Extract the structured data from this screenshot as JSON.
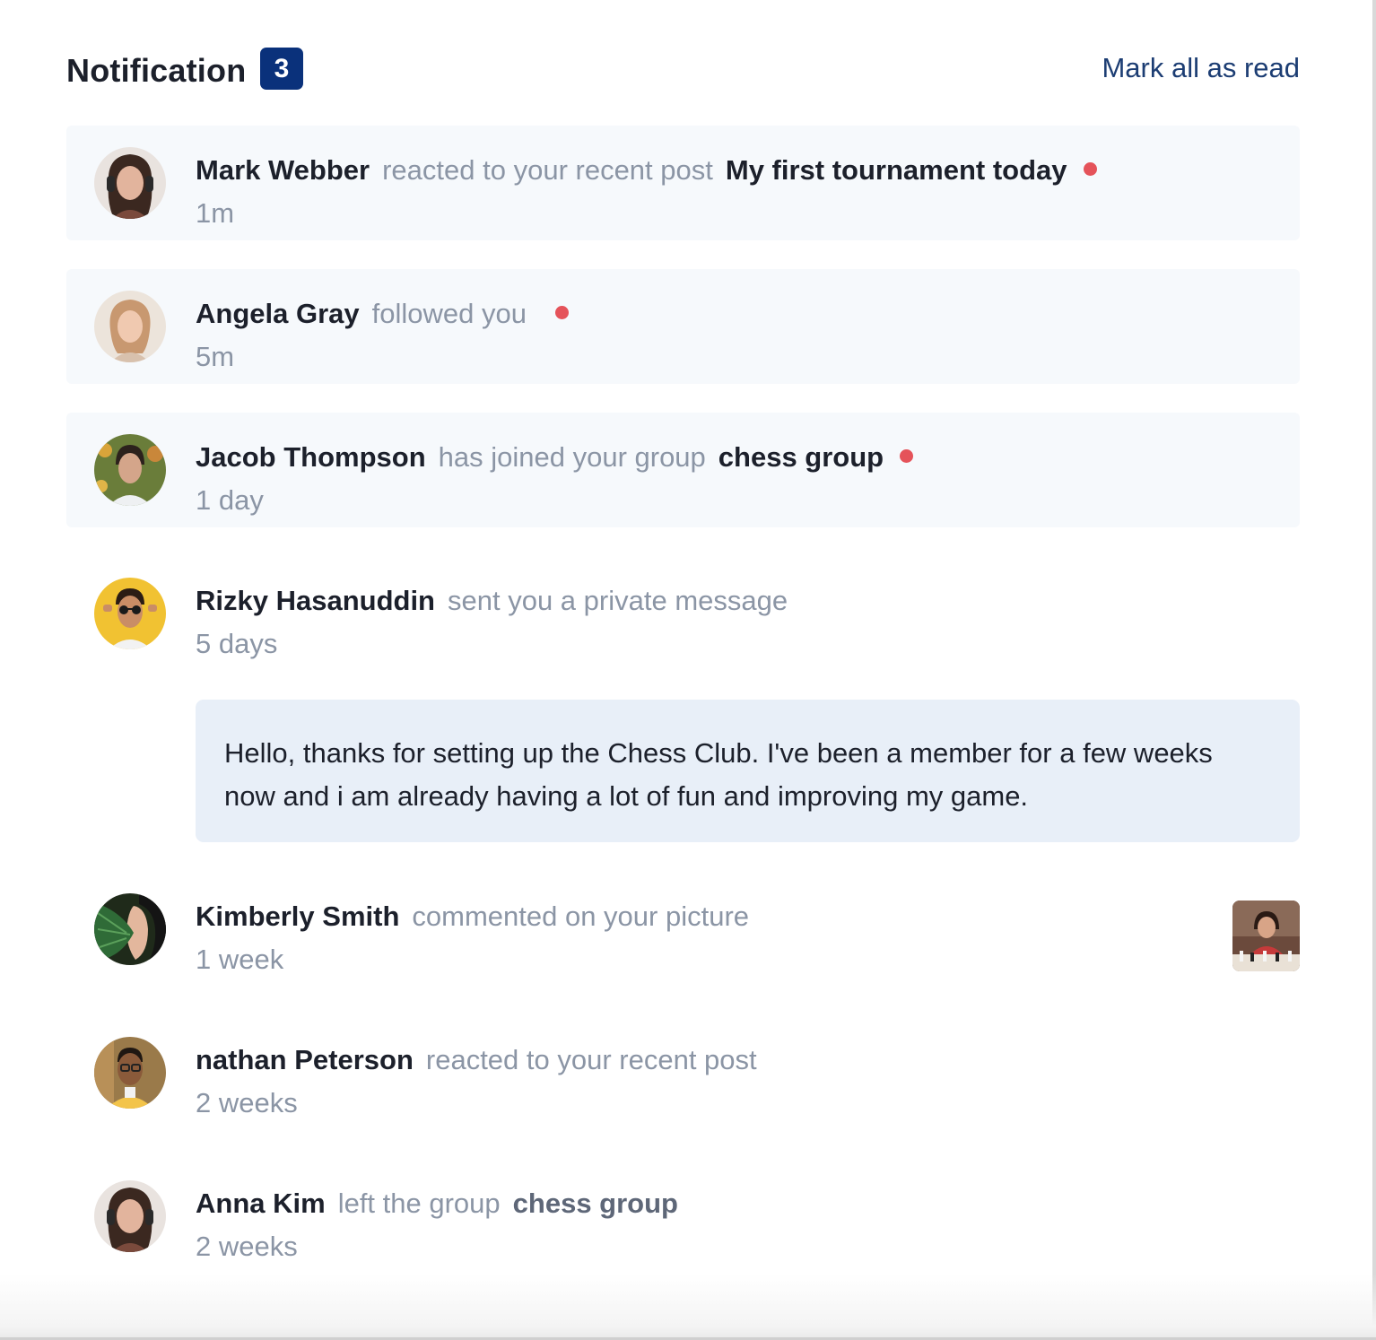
{
  "header": {
    "title": "Notification",
    "unread_count": "3",
    "mark_all_label": "Mark all as read"
  },
  "notifications": [
    {
      "actor": "Mark Webber",
      "action": "reacted to your recent post",
      "target": "My first tournament today",
      "time": "1m",
      "unread": true
    },
    {
      "actor": "Angela Gray",
      "action": "followed you",
      "target": "",
      "time": "5m",
      "unread": true
    },
    {
      "actor": "Jacob Thompson",
      "action": "has joined your group",
      "target": "chess group",
      "time": "1 day",
      "unread": true
    },
    {
      "actor": "Rizky Hasanuddin",
      "action": "sent you a private message",
      "target": "",
      "time": "5 days",
      "unread": false,
      "message": "Hello, thanks for setting up the Chess Club. I've been a member for a few weeks now and i am already having a lot of fun and improving my game."
    },
    {
      "actor": "Kimberly Smith",
      "action": "commented on your picture",
      "target": "",
      "time": "1 week",
      "unread": false
    },
    {
      "actor": "nathan Peterson",
      "action": "reacted to your recent post",
      "target": "",
      "time": "2 weeks",
      "unread": false
    },
    {
      "actor": "Anna Kim",
      "action": "left the group",
      "target": "chess group",
      "time": "2 weeks",
      "unread": false
    }
  ],
  "colors": {
    "badge": "#0a317b",
    "unread_bg": "#f6f9fc",
    "unread_dot": "#e5535a",
    "message_bg": "#e8eff8",
    "muted_text": "#8b95a5",
    "link": "#1c3d73"
  }
}
